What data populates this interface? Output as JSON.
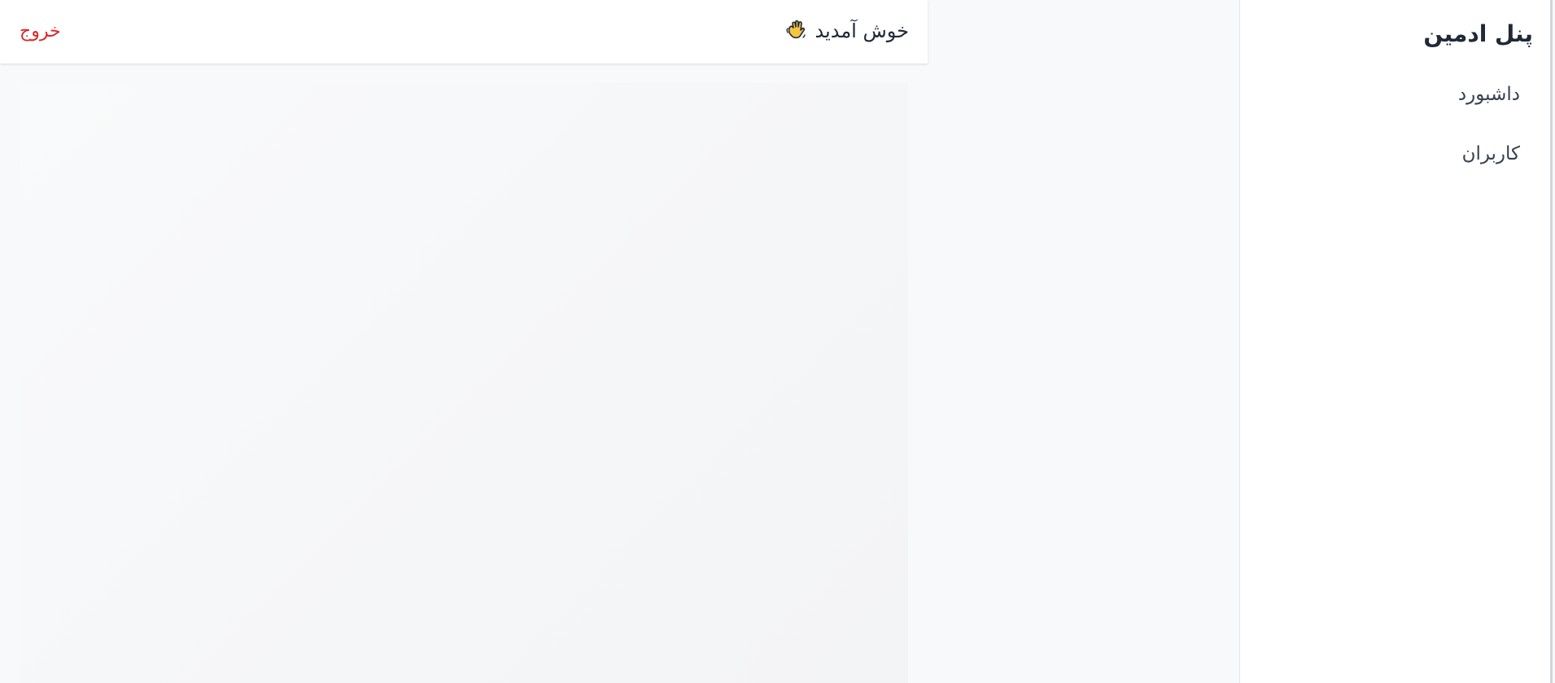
{
  "header": {
    "welcome_text": "خوش آمدید",
    "welcome_icon": "waving-hand-icon",
    "logout_label": "خروج"
  },
  "sidebar": {
    "title": "پنل ادمین",
    "items": [
      {
        "label": "داشبورد"
      },
      {
        "label": "کاربران"
      }
    ]
  },
  "colors": {
    "background": "#f8f9fb",
    "surface": "#ffffff",
    "logout": "#dc2626",
    "text": "#1f2937"
  }
}
